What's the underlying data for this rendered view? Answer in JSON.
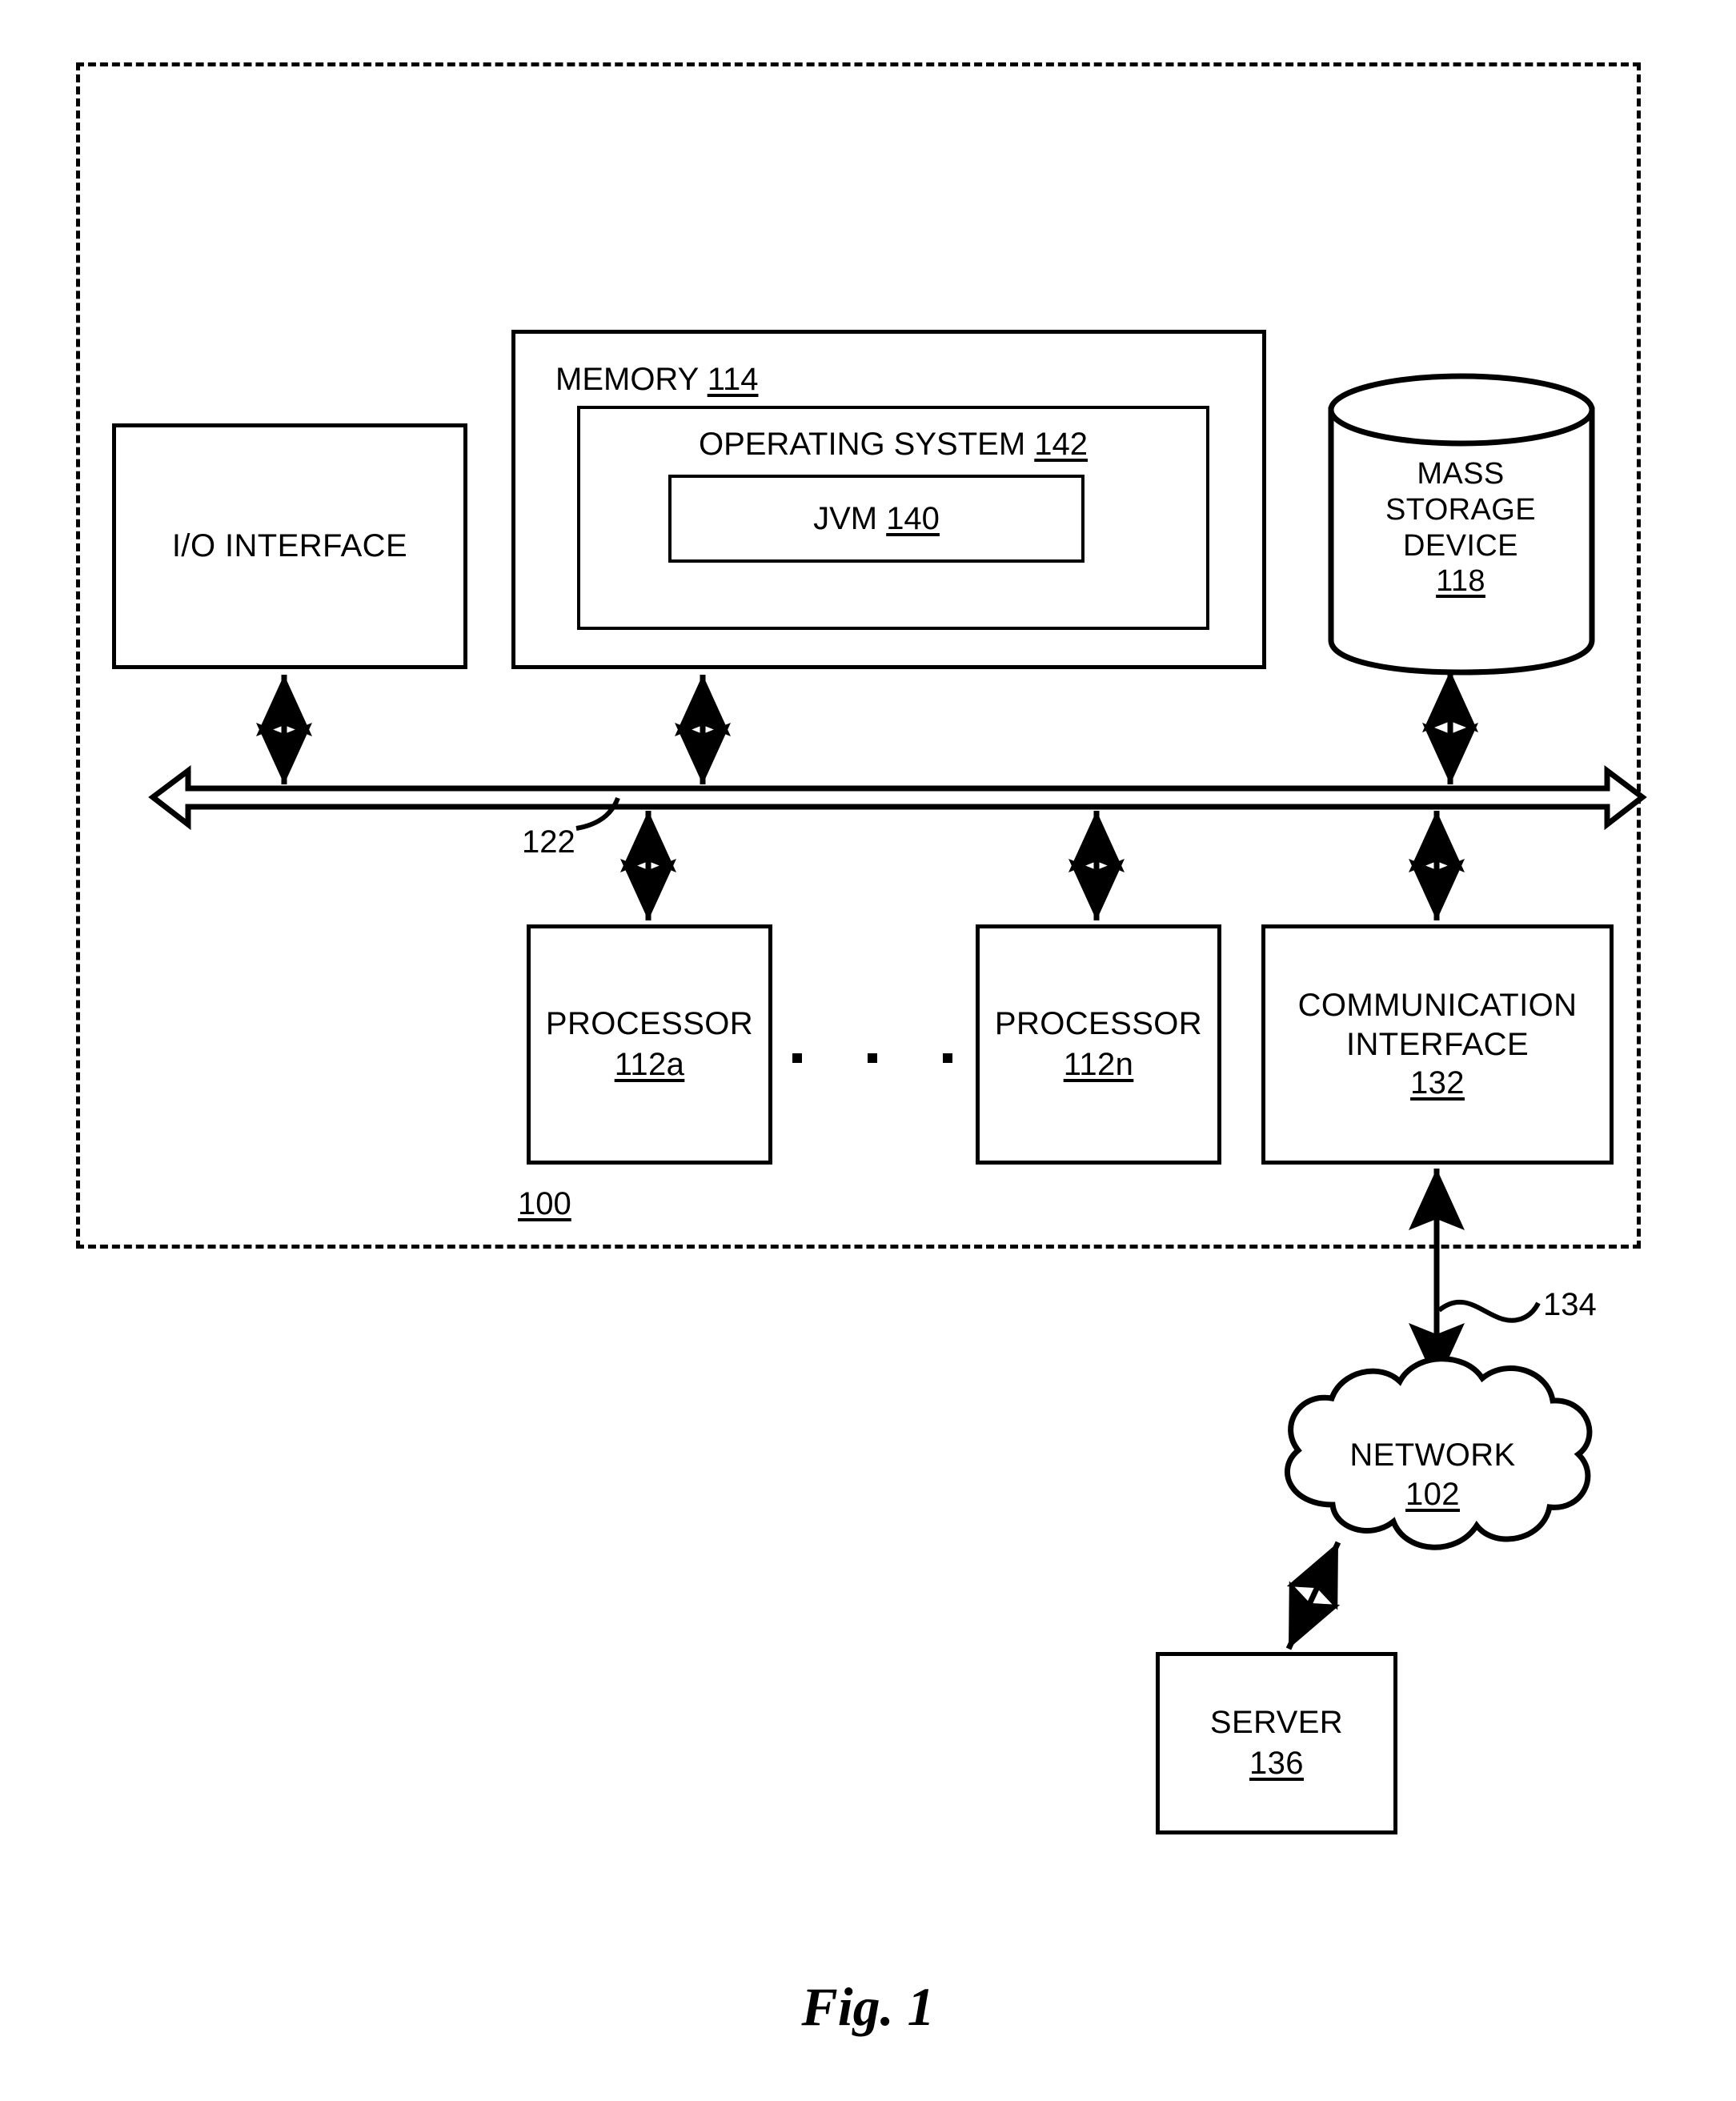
{
  "figure": {
    "caption": "Fig. 1",
    "system_ref": "100",
    "bus_ref": "122",
    "network_link_ref": "134"
  },
  "io_interface": {
    "label": "I/O INTERFACE"
  },
  "memory": {
    "label": "MEMORY",
    "ref": "114",
    "operating_system": {
      "label": "OPERATING SYSTEM",
      "ref": "142",
      "jvm": {
        "label": "JVM",
        "ref": "140"
      }
    }
  },
  "mass_storage": {
    "line1": "MASS",
    "line2": "STORAGE",
    "line3": "DEVICE",
    "ref": "118"
  },
  "processors": [
    {
      "label": "PROCESSOR",
      "ref": "112a"
    },
    {
      "label": "PROCESSOR",
      "ref": "112n"
    }
  ],
  "ellipsis": "· · ·",
  "communication_interface": {
    "line1": "COMMUNICATION",
    "line2": "INTERFACE",
    "ref": "132"
  },
  "network": {
    "label": "NETWORK",
    "ref": "102"
  },
  "server": {
    "label": "SERVER",
    "ref": "136"
  },
  "colors": {
    "stroke": "#000000",
    "background": "#ffffff"
  }
}
